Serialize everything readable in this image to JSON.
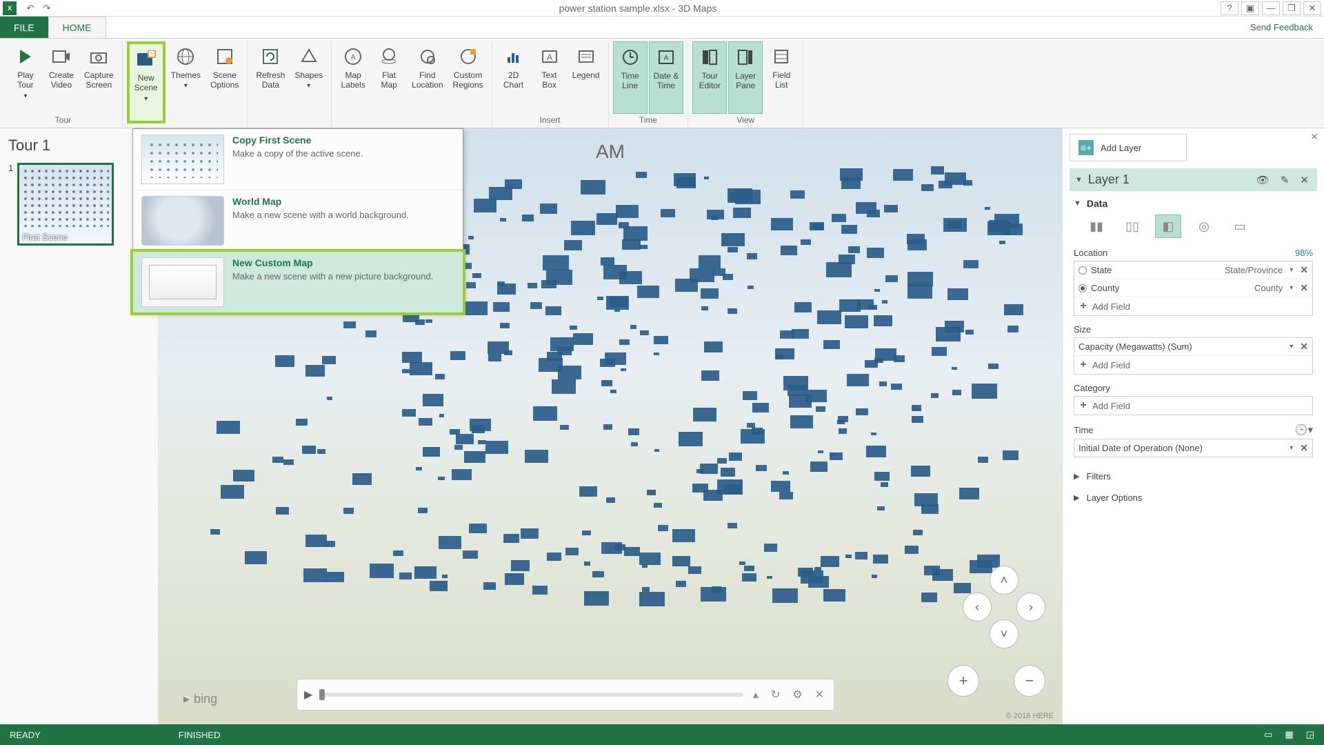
{
  "titlebar": {
    "app_icon": "X",
    "title": "power station sample.xlsx - 3D Maps"
  },
  "tabs": {
    "file": "FILE",
    "home": "HOME",
    "feedback": "Send Feedback"
  },
  "ribbon": {
    "tour": {
      "play": "Play\nTour",
      "create_video": "Create\nVideo",
      "capture": "Capture\nScreen",
      "label": "Tour"
    },
    "scene": {
      "new_scene": "New\nScene",
      "themes": "Themes",
      "scene_options": "Scene\nOptions",
      "label": ""
    },
    "layer": {
      "refresh": "Refresh\nData",
      "shapes": "Shapes",
      "label": ""
    },
    "map": {
      "labels": "Map\nLabels",
      "flat": "Flat\nMap",
      "find": "Find\nLocation",
      "custom": "Custom\nRegions",
      "label": ""
    },
    "insert": {
      "chart": "2D\nChart",
      "textbox": "Text\nBox",
      "legend": "Legend",
      "label": "Insert"
    },
    "time": {
      "timeline": "Time\nLine",
      "datetime": "Date &\nTime",
      "label": "Time"
    },
    "view": {
      "tour_editor": "Tour\nEditor",
      "layer_pane": "Layer\nPane",
      "field_list": "Field\nList",
      "label": "View"
    }
  },
  "scene_menu": {
    "copy": {
      "title": "Copy First Scene",
      "desc": "Make a copy of the active scene."
    },
    "world": {
      "title": "World Map",
      "desc": "Make a new scene with a world background."
    },
    "custom": {
      "title": "New Custom Map",
      "desc": "Make a new scene with a new picture background."
    }
  },
  "tourpanel": {
    "title": "Tour 1",
    "scene_num": "1",
    "scene_label": "First Scene"
  },
  "map": {
    "timestamp": "AM",
    "bing": "bing",
    "copyright": "© 2016 HERE"
  },
  "layer": {
    "add_layer": "Add Layer",
    "name": "Layer 1",
    "data_label": "Data",
    "location": {
      "label": "Location",
      "pct": "98%",
      "state": "State",
      "state_type": "State/Province",
      "county": "County",
      "county_type": "County",
      "add": "Add Field"
    },
    "size": {
      "label": "Size",
      "field": "Capacity (Megawatts) (Sum)",
      "add": "Add Field"
    },
    "category": {
      "label": "Category",
      "add": "Add Field"
    },
    "time": {
      "label": "Time",
      "field": "Initial Date of Operation (None)"
    },
    "filters": "Filters",
    "options": "Layer Options"
  },
  "status": {
    "ready": "READY",
    "finished": "FINISHED"
  }
}
